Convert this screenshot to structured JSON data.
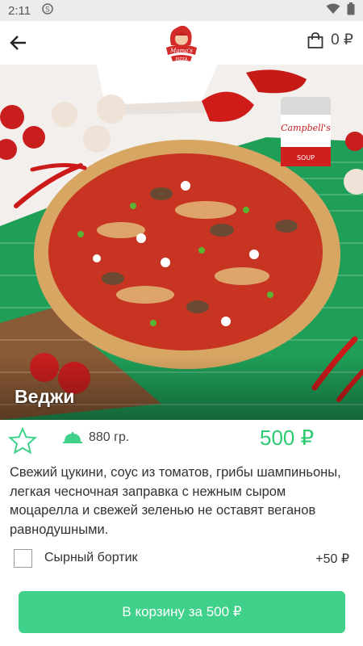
{
  "status_bar": {
    "time": "2:11",
    "app_icon": "s-notification-icon",
    "wifi_icon": "wifi-icon",
    "battery_icon": "battery-icon"
  },
  "app_bar": {
    "back_icon": "arrow-left-icon",
    "logo_icon": "mama-pizza-logo",
    "cart_icon": "shopping-bag-icon",
    "cart_total": "0 ₽"
  },
  "product": {
    "name": "Веджи",
    "weight_icon": "cloche-icon",
    "weight": "880 гр.",
    "price": "500 ₽",
    "description": "Свежий цукини, соус из томатов, грибы шампиньоны, легкая чесночная заправка с нежным сыром моцарелла и свежей зеленью не оставят веганов равнодушными."
  },
  "addon": {
    "label": "Сырный бортик",
    "price": "+50 ₽",
    "checked": false
  },
  "cta_label": "В корзину за 500 ₽",
  "colors": {
    "accent": "#3fd18a",
    "price": "#2ecc71",
    "hero_cloth": "#1f9e57"
  }
}
